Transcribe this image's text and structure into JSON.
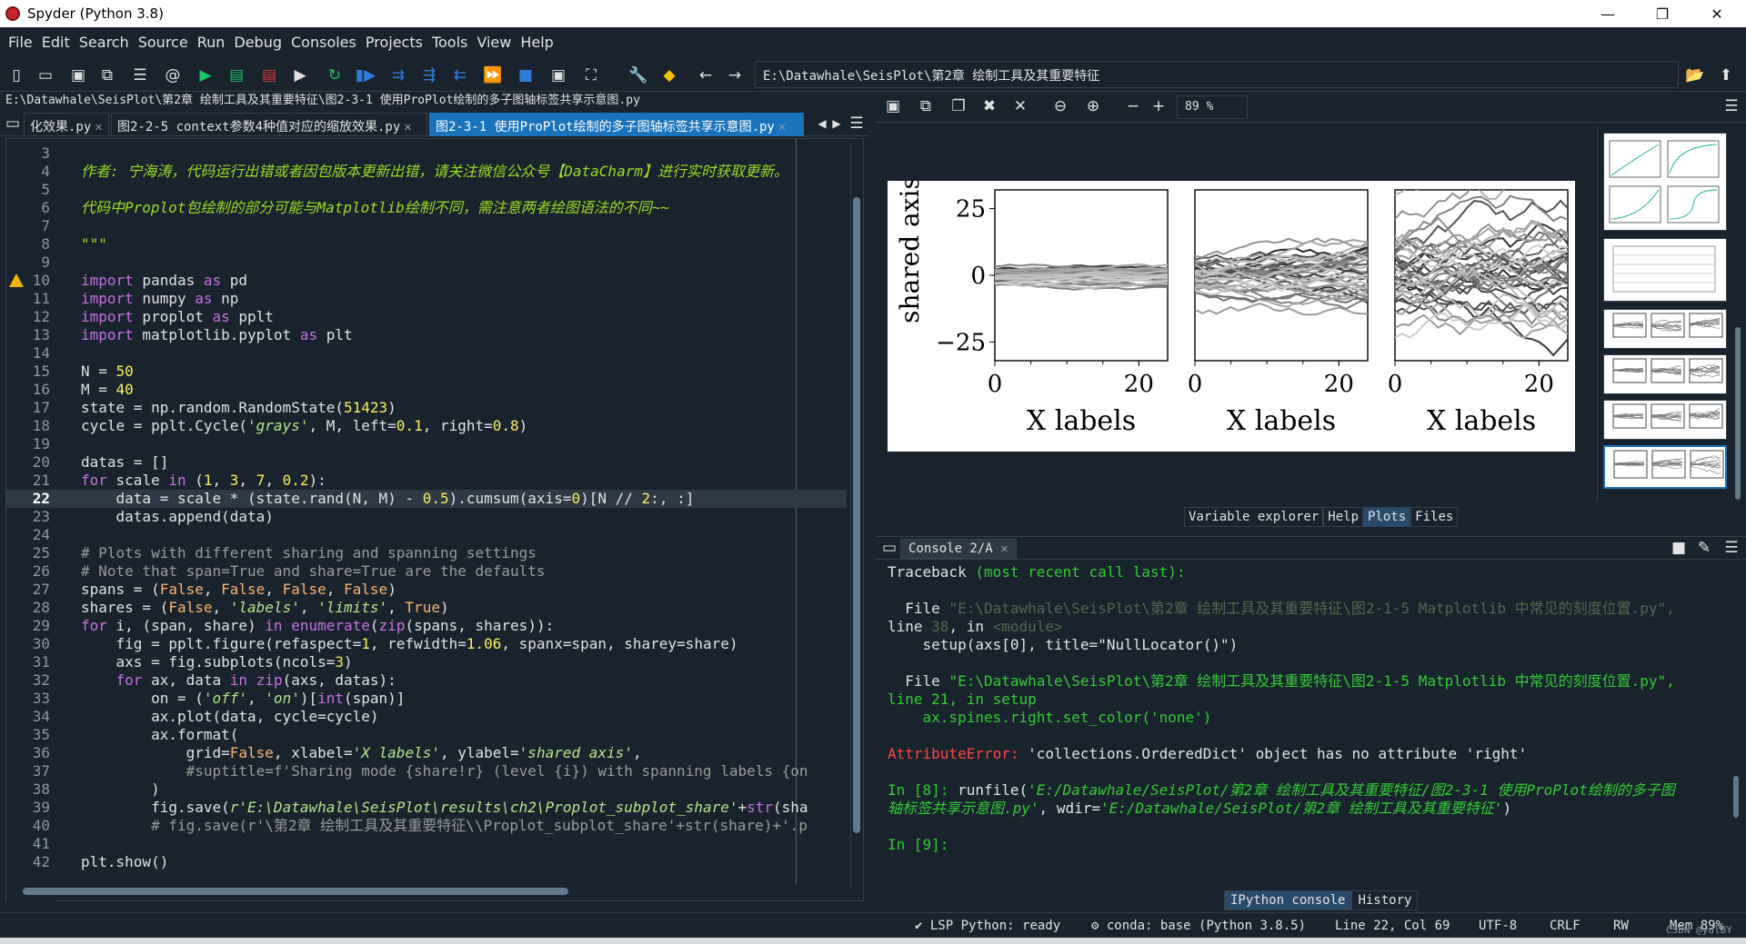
{
  "window": {
    "title": "Spyder (Python 3.8)",
    "minimize": "—",
    "restore": "❐",
    "close": "✕"
  },
  "menu": [
    "File",
    "Edit",
    "Search",
    "Source",
    "Run",
    "Debug",
    "Consoles",
    "Projects",
    "Tools",
    "View",
    "Help"
  ],
  "toolbar": {
    "path": "E:\\Datawhale\\SeisPlot\\第2章 绘制工具及其重要特征"
  },
  "editor": {
    "filepath": "E:\\Datawhale\\SeisPlot\\第2章 绘制工具及其重要特征\\图2-3-1 使用ProPlot绘制的多子图轴标签共享示意图.py",
    "tabs": [
      "化效果.py",
      "图2-2-5 context参数4种值对应的缩放效果.py",
      "图2-3-1 使用ProPlot绘制的多子图轴标签共享示意图.py"
    ],
    "lines": [
      "3",
      "4",
      "5",
      "6",
      "7",
      "8",
      "9",
      "10",
      "11",
      "12",
      "13",
      "14",
      "15",
      "16",
      "17",
      "18",
      "19",
      "20",
      "21",
      "22",
      "23",
      "24",
      "25",
      "26",
      "27",
      "28",
      "29",
      "30",
      "31",
      "32",
      "33",
      "34",
      "35",
      "36",
      "37",
      "38",
      "39",
      "40",
      "41",
      "42"
    ]
  },
  "plots": {
    "zoom": "89 %",
    "tabs": [
      "Variable explorer",
      "Help",
      "Plots",
      "Files"
    ],
    "figure_text": {
      "ylabel": "shared axis",
      "xlabel": "X labels",
      "yticks": [
        "25",
        "0",
        "−25"
      ],
      "xticks": [
        "0",
        "20"
      ]
    }
  },
  "console": {
    "tab": "Console 2/A",
    "tabs": [
      "IPython console",
      "History"
    ],
    "l1": "Traceback ",
    "l1b": "(most recent call last):",
    "l2a": "  File ",
    "l2b": "\"E:\\Datawhale\\SeisPlot\\第2章 绘制工具及其重要特征\\图2-1-5 Matplotlib 中常见的刻度位置.py\",",
    "l3a": "line ",
    "l3b": "38",
    "l3c": ", in ",
    "l3d": "<module>",
    "l4": "    setup(axs[0], title=\"NullLocator()\")",
    "l5a": "  File ",
    "l5b": "\"E:\\Datawhale\\SeisPlot\\第2章 绘制工具及其重要特征\\图2-1-5 Matplotlib 中常见的刻度位置.py\",",
    "l6": "line 21, in setup",
    "l7": "    ax.spines.right.set_color('none')",
    "l8a": "AttributeError: ",
    "l8b": "'collections.OrderedDict' object has no attribute 'right'",
    "l9a": "In [8]: ",
    "l9b": "runfile(",
    "l9c": "'E:/Datawhale/SeisPlot/第2章 绘制工具及其重要特征/图2-3-1 使用ProPlot绘制的多子图",
    "l10a": "轴标签共享示意图.py'",
    "l10b": ", wdir=",
    "l10c": "'E:/Datawhale/SeisPlot/第2章 绘制工具及其重要特征'",
    "l10d": ")",
    "l11": "In [9]:"
  },
  "status": {
    "lsp": "LSP Python: ready",
    "conda": "conda: base (Python 3.8.5)",
    "pos": "Line 22, Col 69",
    "enc": "UTF-8",
    "eol": "CRLF",
    "rw": "RW",
    "mem": "Mem 89%",
    "watermark": "CSDN @ydlBY"
  }
}
